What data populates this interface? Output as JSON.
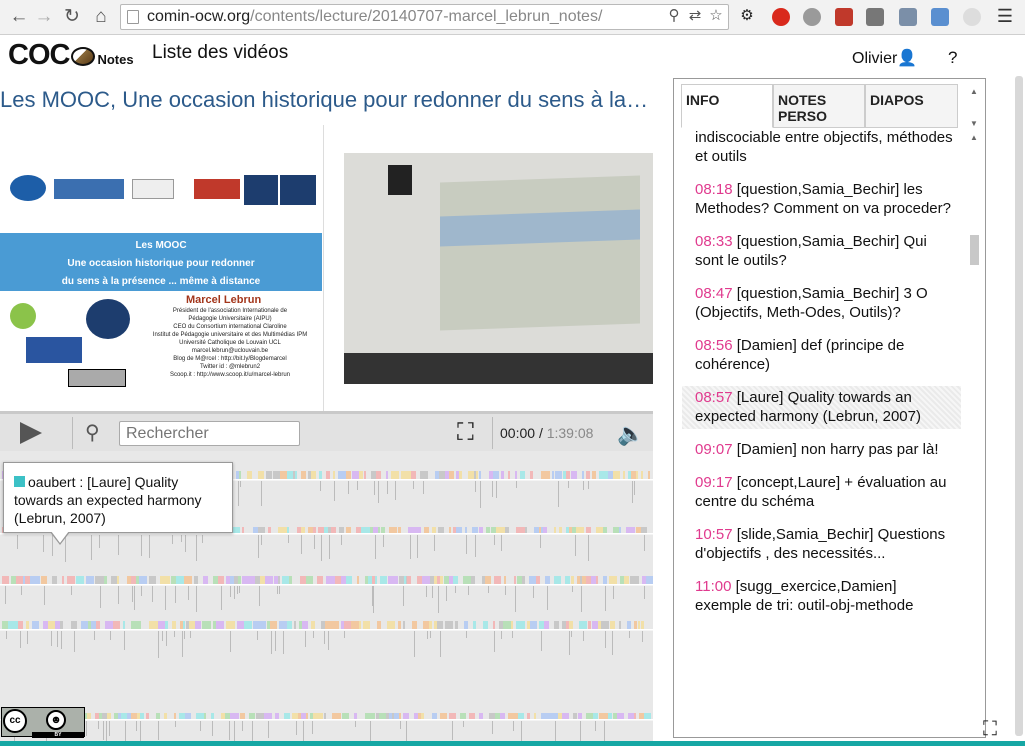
{
  "browser": {
    "url_host": "comin-ocw.org",
    "url_path": "/contents/lecture/20140707-marcel_lebrun_notes/"
  },
  "app": {
    "logo": "COC",
    "logo_suffix": "Notes",
    "nav_title": "Liste des vidéos",
    "user_name": "Olivier",
    "help": "?"
  },
  "video": {
    "title": "Les MOOC, Une occasion historique pour redonner du sens à la présence...",
    "slide_heading": "Les MOOC",
    "slide_sub1": "Une occasion historique pour redonner",
    "slide_sub2": "du sens à la présence ... même à distance",
    "slide_author": "Marcel Lebrun",
    "slide_lines": [
      "Président de l'association Internationale de",
      "Pédagogie Universitaire (AIPU)",
      "CEO du Consortium international Claroline",
      "Institut de Pédagogie universitaire et des Multimédias IPM",
      "Université Catholique de Louvain UCL",
      "marcel.lebrun@uclouvain.be",
      "Blog de M@rcel : http://bit.ly/Blogdemarcel",
      "Twitter id : @mlebrun2",
      "Scoop.it : http://www.scoop.it/u/marcel-lebrun"
    ]
  },
  "controls": {
    "search_placeholder": "Rechercher",
    "current_time": "00:00",
    "separator": "/",
    "duration": "1:39:08"
  },
  "tooltip": {
    "text": "oaubert : [Laure] Quality towards an expected harmony (Lebrun, 2007)",
    "color": "#3cc1c6"
  },
  "license": {
    "cc": "cc",
    "by_label": "BY"
  },
  "panel": {
    "tabs": [
      "INFO",
      "NOTES PERSO",
      "DIAPOS"
    ],
    "notes": [
      {
        "ts": "",
        "text": "indiscociable entre objectifs, méthodes et outils",
        "highlight": false
      },
      {
        "ts": "08:18",
        "text": "[question,Samia_Bechir] les Methodes? Comment on va proceder?",
        "highlight": false
      },
      {
        "ts": "08:33",
        "text": "[question,Samia_Bechir] Qui sont le outils?",
        "highlight": false
      },
      {
        "ts": "08:47",
        "text": "[question,Samia_Bechir] 3 O (Objectifs, Meth-Odes, Outils)?",
        "highlight": false
      },
      {
        "ts": "08:56",
        "text": "[Damien] def (principe de cohérence)",
        "highlight": false
      },
      {
        "ts": "08:57",
        "text": "[Laure] Quality towards an expected harmony (Lebrun, 2007)",
        "highlight": true
      },
      {
        "ts": "09:07",
        "text": "[Damien] non harry pas par là!",
        "highlight": false
      },
      {
        "ts": "09:17",
        "text": "[concept,Laure] + évaluation au centre du schéma",
        "highlight": false
      },
      {
        "ts": "10:57",
        "text": "[slide,Samia_Bechir] Questions d'objectifs , des necessités...",
        "highlight": false
      },
      {
        "ts": "11:00",
        "text": "[sugg_exercice,Damien] exemple de tri: outil-obj-methode",
        "highlight": false
      }
    ]
  },
  "colors": {
    "title_blue": "#2c5a8a",
    "timestamp_pink": "#e03a8e",
    "slide_blue": "#4a9bd4",
    "accent_teal": "#16a7a4"
  }
}
